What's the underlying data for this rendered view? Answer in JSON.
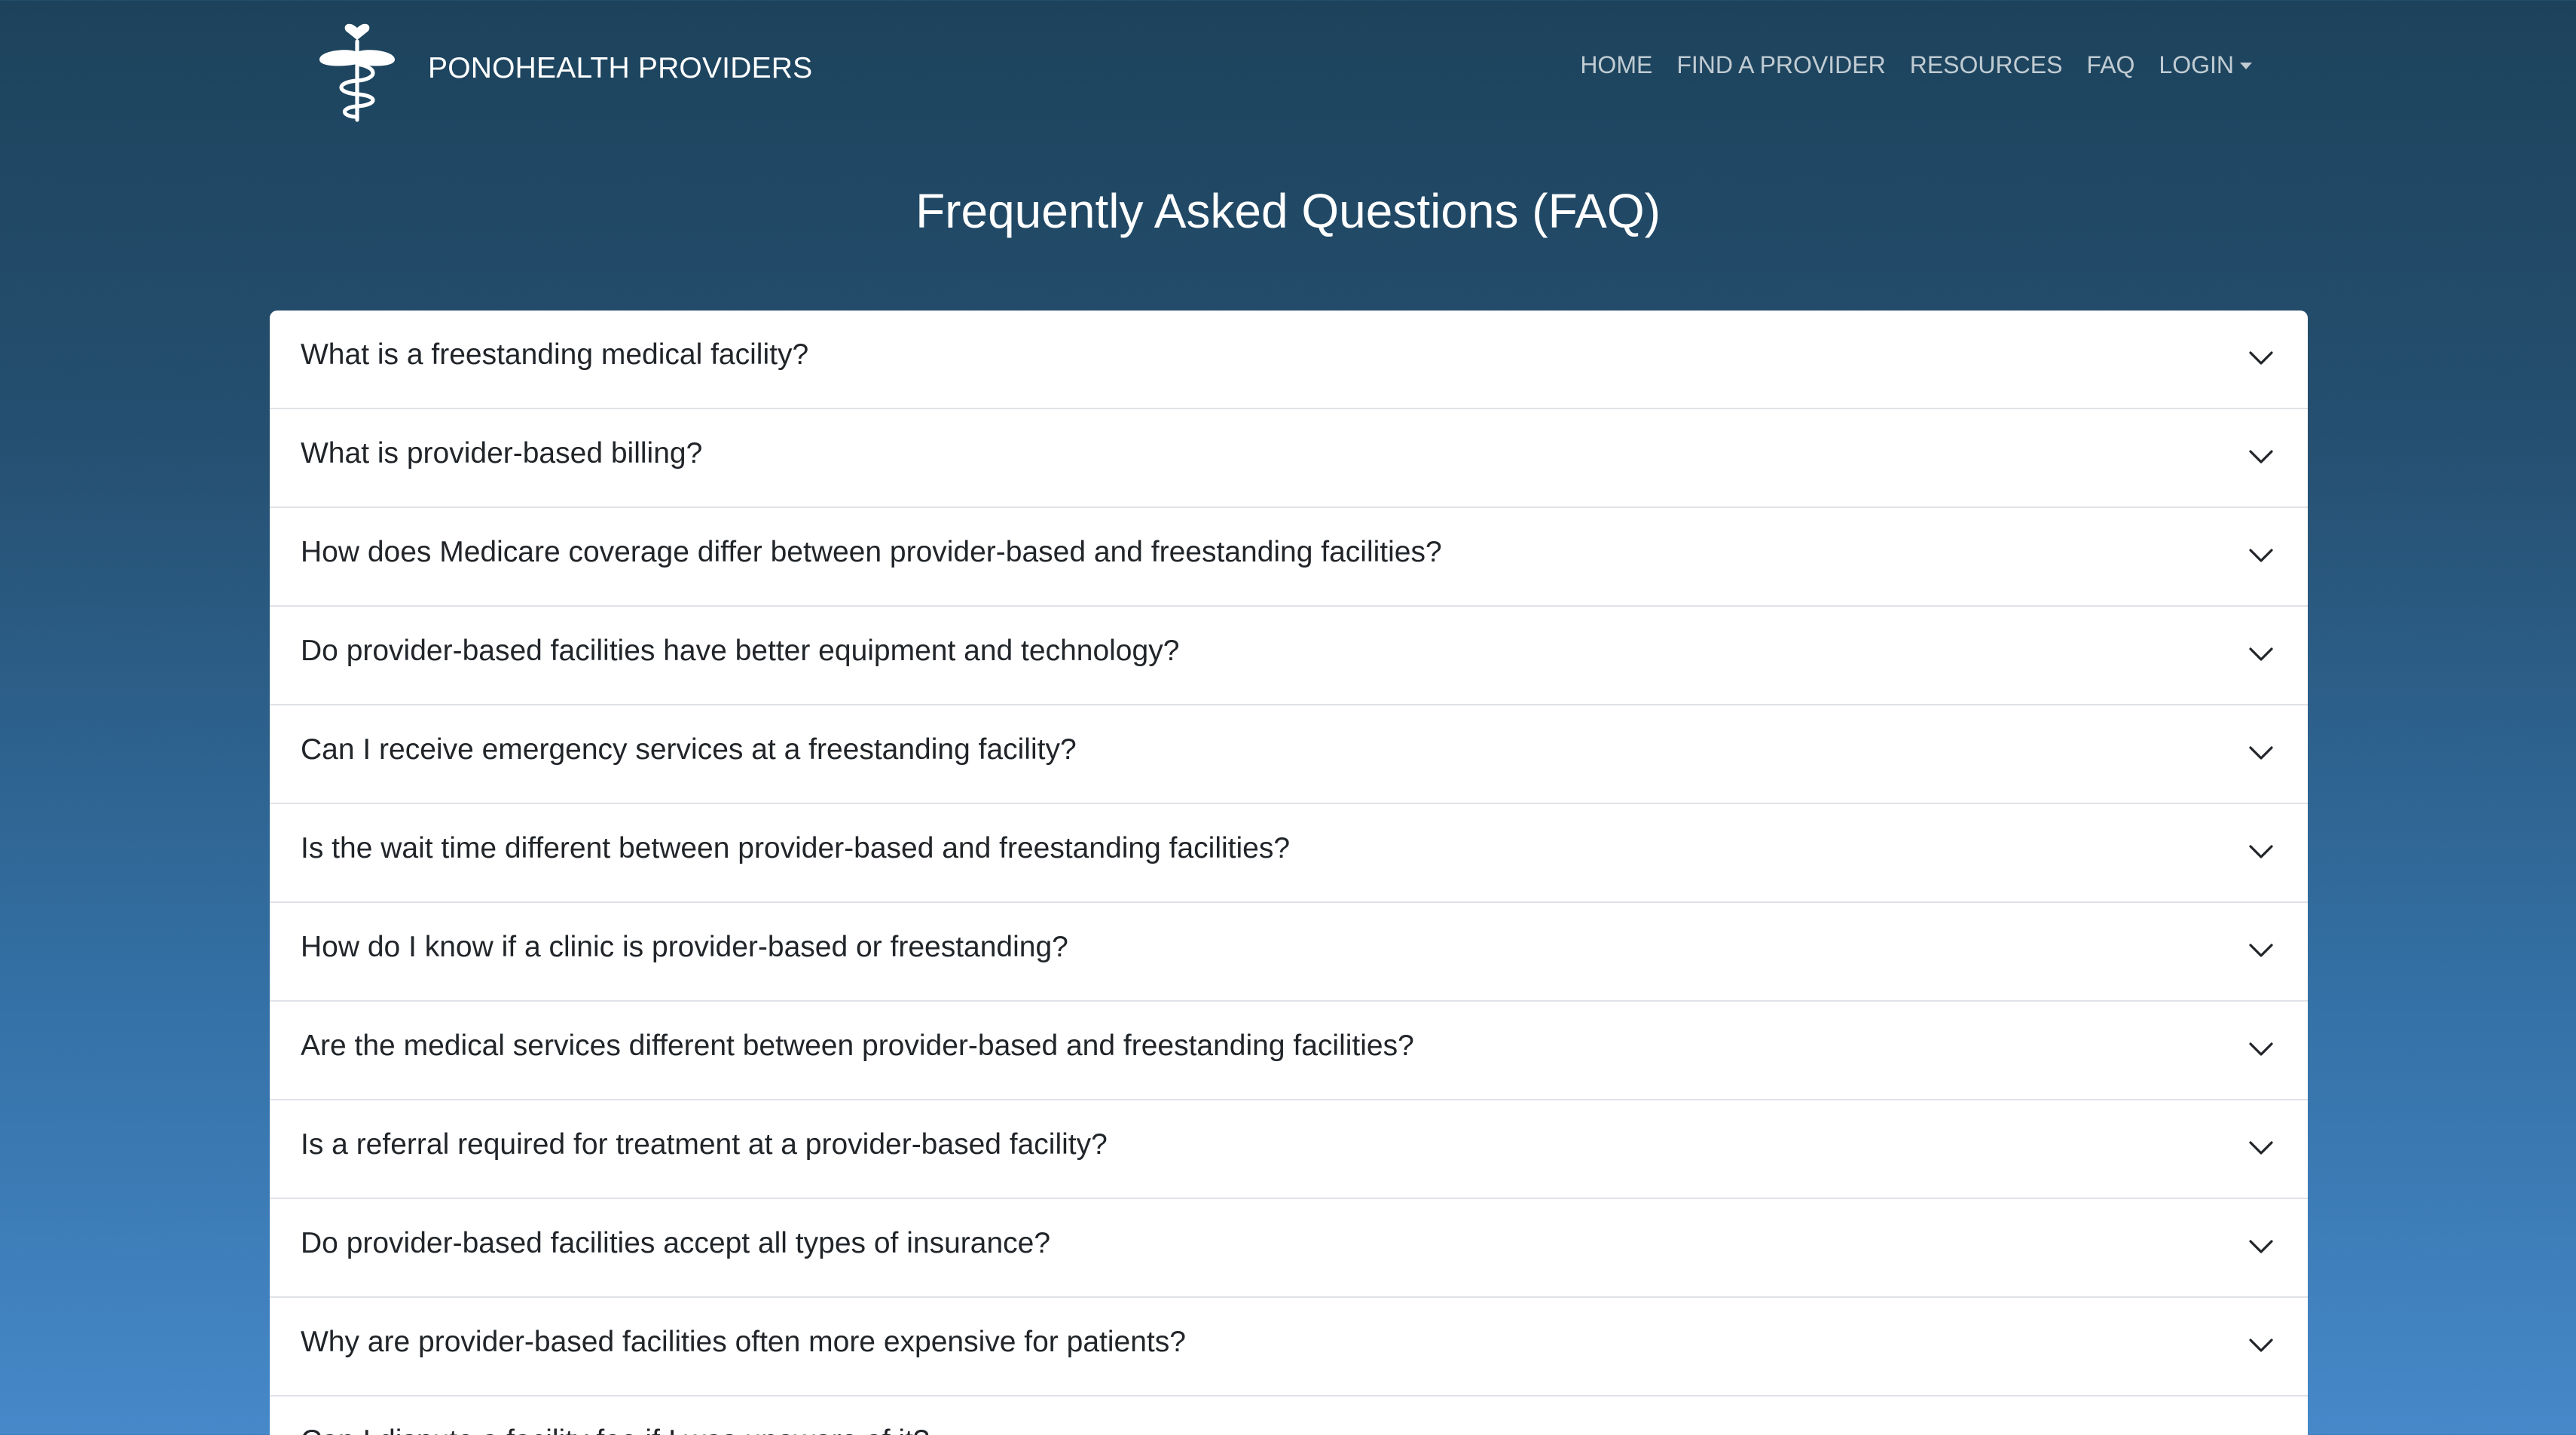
{
  "brand": {
    "name": "PONOHEALTH PROVIDERS",
    "logo_icon": "caduceus-heart-icon"
  },
  "nav": {
    "items": [
      {
        "label": "HOME"
      },
      {
        "label": "FIND A PROVIDER"
      },
      {
        "label": "RESOURCES"
      },
      {
        "label": "FAQ"
      },
      {
        "label": "LOGIN",
        "has_dropdown": true
      }
    ]
  },
  "page": {
    "title": "Frequently Asked Questions (FAQ)"
  },
  "faq": {
    "items": [
      {
        "question": "What is a freestanding medical facility?",
        "expanded": false
      },
      {
        "question": "What is provider-based billing?",
        "expanded": false
      },
      {
        "question": "How does Medicare coverage differ between provider-based and freestanding facilities?",
        "expanded": false
      },
      {
        "question": "Do provider-based facilities have better equipment and technology?",
        "expanded": false
      },
      {
        "question": "Can I receive emergency services at a freestanding facility?",
        "expanded": false
      },
      {
        "question": "Is the wait time different between provider-based and freestanding facilities?",
        "expanded": false
      },
      {
        "question": "How do I know if a clinic is provider-based or freestanding?",
        "expanded": false
      },
      {
        "question": "Are the medical services different between provider-based and freestanding facilities?",
        "expanded": false
      },
      {
        "question": "Is a referral required for treatment at a provider-based facility?",
        "expanded": false
      },
      {
        "question": "Do provider-based facilities accept all types of insurance?",
        "expanded": false
      },
      {
        "question": "Why are provider-based facilities often more expensive for patients?",
        "expanded": false
      },
      {
        "question": "Can I dispute a facility fee if I was unaware of it?",
        "expanded": false
      }
    ]
  },
  "colors": {
    "header_bg": "#1d435c",
    "bottom_bg": "#4688c9",
    "card_bg": "#ffffff",
    "question_text": "#212529",
    "divider": "#dfe2e6"
  }
}
